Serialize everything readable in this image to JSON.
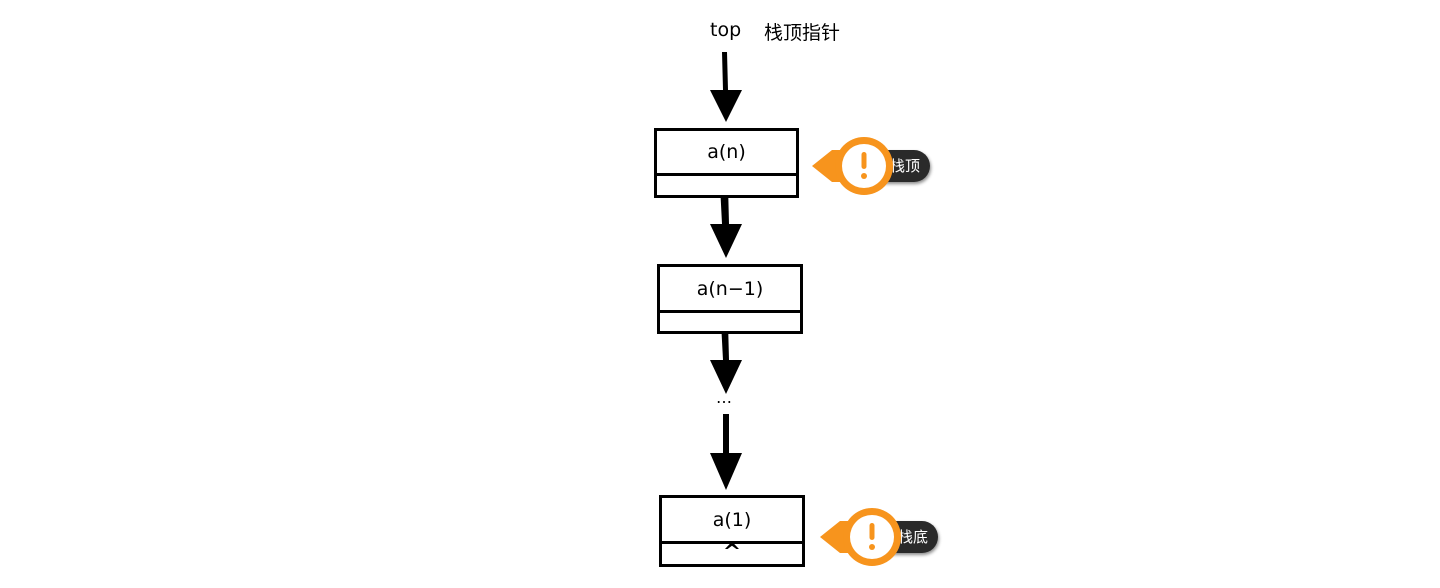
{
  "pointer": {
    "label": "top",
    "description": "栈顶指针"
  },
  "nodes": [
    {
      "value": "a(n)"
    },
    {
      "value": "a(n−1)"
    },
    {
      "value": "a(1)",
      "next": "^"
    }
  ],
  "ellipsis": "…",
  "callouts": {
    "top": {
      "label": "栈顶",
      "icon": "exclamation-icon"
    },
    "bottom": {
      "label": "栈底",
      "icon": "exclamation-icon"
    }
  },
  "colors": {
    "callout_orange": "#f7941d",
    "callout_dark": "#2a2a2a",
    "line": "#000000"
  }
}
